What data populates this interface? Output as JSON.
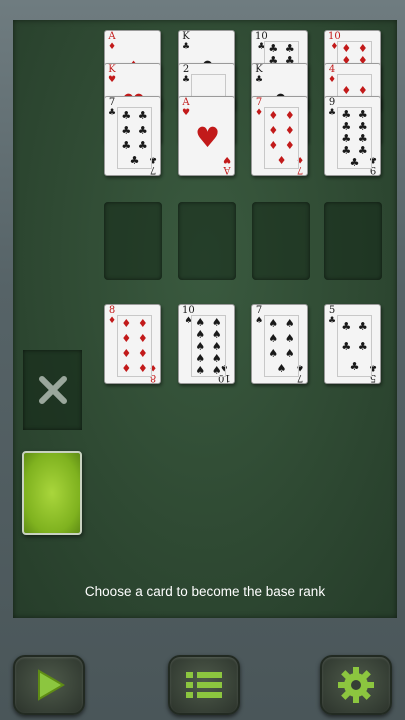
{
  "status_text": "Choose a card to become the base rank",
  "colors": {
    "felt": "#2f4a33",
    "accent": "#8cc63f",
    "red_suit": "#c21a1a"
  },
  "foundation_columns": [
    {
      "cards": [
        {
          "rank": "A",
          "suit": "♦",
          "color": "red"
        },
        {
          "rank": "K",
          "suit": "♥",
          "color": "red"
        },
        {
          "rank": "7",
          "suit": "♣",
          "color": "black"
        }
      ]
    },
    {
      "cards": [
        {
          "rank": "K",
          "suit": "♣",
          "color": "black"
        },
        {
          "rank": "2",
          "suit": "♣",
          "color": "black"
        },
        {
          "rank": "A",
          "suit": "♥",
          "color": "red"
        }
      ]
    },
    {
      "cards": [
        {
          "rank": "10",
          "suit": "♣",
          "color": "black"
        },
        {
          "rank": "K",
          "suit": "♣",
          "color": "black"
        },
        {
          "rank": "7",
          "suit": "♦",
          "color": "red"
        }
      ]
    },
    {
      "cards": [
        {
          "rank": "10",
          "suit": "♦",
          "color": "red"
        },
        {
          "rank": "4",
          "suit": "♦",
          "color": "red"
        },
        {
          "rank": "9",
          "suit": "♣",
          "color": "black"
        }
      ]
    }
  ],
  "tableau_cards": [
    {
      "rank": "8",
      "suit": "♦",
      "color": "red"
    },
    {
      "rank": "10",
      "suit": "♠",
      "color": "black"
    },
    {
      "rank": "7",
      "suit": "♠",
      "color": "black"
    },
    {
      "rank": "5",
      "suit": "♣",
      "color": "black"
    }
  ],
  "icons": {
    "discard": "close-icon",
    "play": "play-icon",
    "menu": "menu-icon",
    "settings": "gear-icon"
  }
}
